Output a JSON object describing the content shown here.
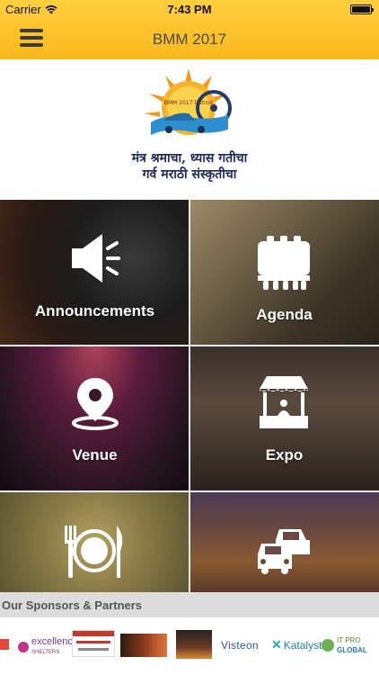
{
  "status_bar": {
    "carrier": "Carrier",
    "time": "7:43 PM"
  },
  "nav": {
    "title": "BMM 2017",
    "menu_icon": "hamburger-menu-icon"
  },
  "logo": {
    "tagline_line1": "मंत्र श्रमाचा, ध्यास गतीचा",
    "tagline_line2": "गर्व मराठी संस्कृतीचा",
    "emblem_text": "BMM 2017 Detroit"
  },
  "tiles": [
    {
      "label": "Announcements",
      "icon": "megaphone-icon"
    },
    {
      "label": "Agenda",
      "icon": "calendar-icon"
    },
    {
      "label": "Venue",
      "icon": "map-pin-icon"
    },
    {
      "label": "Expo",
      "icon": "market-stall-icon"
    },
    {
      "label": "",
      "icon": "dining-plate-icon"
    },
    {
      "label": "",
      "icon": "cars-icon"
    }
  ],
  "sponsors": {
    "header": "Our Sponsors & Partners",
    "items": [
      {
        "name": "excellence",
        "sub": "SHELTERS"
      },
      {
        "name": "Visteon"
      },
      {
        "name": "Katalyst"
      },
      {
        "name": "IT PRO",
        "sub": "GLOBAL"
      }
    ]
  },
  "colors": {
    "nav_gradient_top": "#ffcf3f",
    "nav_gradient_bottom": "#f9b81c",
    "tagline": "#1d2a5c",
    "sponsor_header_bg": "#dcdcdc"
  }
}
